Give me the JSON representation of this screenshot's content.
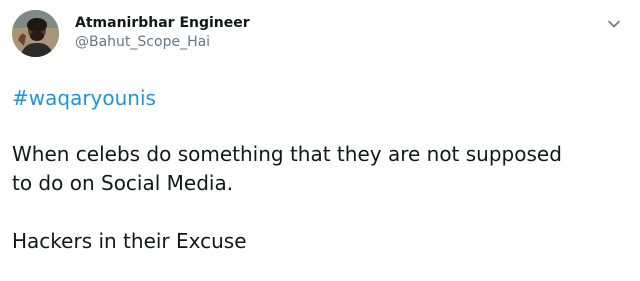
{
  "user": {
    "display_name": "Atmanirbhar Engineer",
    "handle": "@Bahut_Scope_Hai"
  },
  "tweet": {
    "hashtag": "#waqaryounis",
    "line1": "When celebs do something that they are not supposed",
    "line2": "to do on Social Media.",
    "line3": "Hackers in their Excuse"
  },
  "icons": {
    "menu": "chevron-down-icon",
    "avatar": "user-avatar"
  },
  "colors": {
    "hashtag": "#1b95e0",
    "handle": "#657786",
    "text": "#14171a"
  }
}
